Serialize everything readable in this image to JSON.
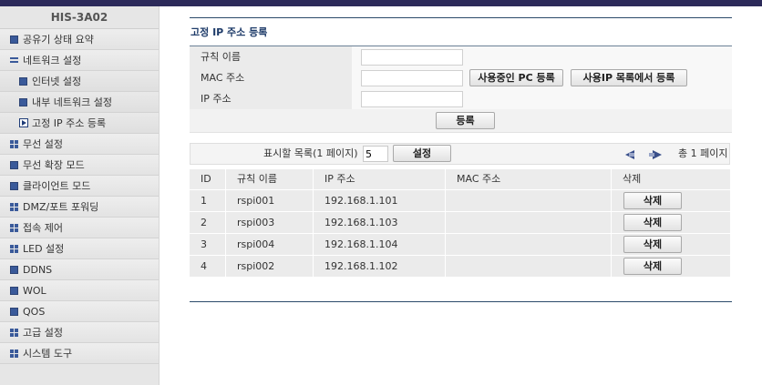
{
  "sidebar": {
    "title": "HIS-3A02",
    "items": [
      {
        "label": "공유기 상태 요약",
        "icon": "square-icon",
        "sub": false
      },
      {
        "label": "네트워크 설정",
        "icon": "lines-icon",
        "sub": false
      },
      {
        "label": "인터넷 설정",
        "icon": "square-icon",
        "sub": true
      },
      {
        "label": "내부 네트워크 설정",
        "icon": "square-icon",
        "sub": true
      },
      {
        "label": "고정 IP 주소 등록",
        "icon": "play-icon",
        "sub": true
      },
      {
        "label": "무선 설정",
        "icon": "grid-icon",
        "sub": false
      },
      {
        "label": "무선 확장 모드",
        "icon": "square-icon",
        "sub": false
      },
      {
        "label": "클라이언트 모드",
        "icon": "square-icon",
        "sub": false
      },
      {
        "label": "DMZ/포트 포워딩",
        "icon": "grid-icon",
        "sub": false
      },
      {
        "label": "접속 제어",
        "icon": "grid-icon",
        "sub": false
      },
      {
        "label": "LED 설정",
        "icon": "grid-icon",
        "sub": false
      },
      {
        "label": "DDNS",
        "icon": "square-icon",
        "sub": false
      },
      {
        "label": "WOL",
        "icon": "square-icon",
        "sub": false
      },
      {
        "label": "QOS",
        "icon": "square-icon",
        "sub": false
      },
      {
        "label": "고급 설정",
        "icon": "grid-icon",
        "sub": false
      },
      {
        "label": "시스템 도구",
        "icon": "grid-icon",
        "sub": false
      }
    ]
  },
  "main": {
    "title": "고정 IP 주소 등록",
    "form": {
      "rule_name_label": "규칙 이름",
      "rule_name_value": "",
      "mac_label": "MAC 주소",
      "mac_value": "",
      "register_pc_button": "사용중인 PC 등록",
      "register_from_list_button": "사용IP 목록에서 등록",
      "ip_label": "IP 주소",
      "ip_value": "",
      "submit_button": "등록"
    },
    "pager": {
      "label": "표시할 목록(1 페이지)",
      "count_value": "5",
      "set_button": "설정",
      "total": "총 1 페이지"
    },
    "table": {
      "headers": {
        "id": "ID",
        "rule": "규칙 이름",
        "ip": "IP 주소",
        "mac": "MAC 주소",
        "del": "삭제"
      },
      "rows": [
        {
          "id": "1",
          "rule": "rspi001",
          "ip": "192.168.1.101",
          "mac": "",
          "del": "삭제"
        },
        {
          "id": "2",
          "rule": "rspi003",
          "ip": "192.168.1.103",
          "mac": "",
          "del": "삭제"
        },
        {
          "id": "3",
          "rule": "rspi004",
          "ip": "192.168.1.104",
          "mac": "",
          "del": "삭제"
        },
        {
          "id": "4",
          "rule": "rspi002",
          "ip": "192.168.1.102",
          "mac": "",
          "del": "삭제"
        }
      ]
    }
  },
  "colors": {
    "topbar": "#2c2a5a",
    "accent": "#1f3c6a",
    "icon": "#3a5a9a"
  }
}
